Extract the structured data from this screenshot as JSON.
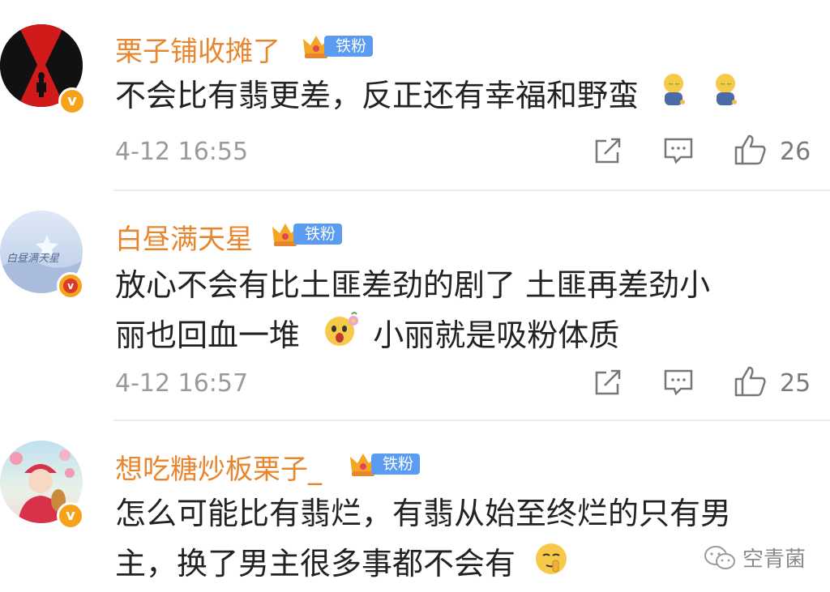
{
  "comments": [
    {
      "username": "栗子铺收摊了",
      "badge": "铁粉",
      "text_lines": [
        "不会比有翡更差，反正还有幸福和野蛮"
      ],
      "time": "4-12 16:55",
      "likes": "26",
      "avatar_icon": "black-widow-avatar"
    },
    {
      "username": "白昼满天星",
      "badge": "铁粉",
      "avatar_text": "白昼满天星",
      "text_lines": [
        "放心不会有比土匪差劲的剧了 土匪再差劲小",
        "丽也回血一堆",
        "小丽就是吸粉体质"
      ],
      "time": "4-12 16:57",
      "likes": "25"
    },
    {
      "username": "想吃糖炒板栗子_",
      "badge": "铁粉",
      "text_lines": [
        "怎么可能比有翡烂，有翡从始至终烂的只有男",
        "主，换了男主很多事都不会有"
      ]
    }
  ],
  "watermark": "空青菌",
  "colors": {
    "username": "#e8852f",
    "badge": "#5b9cf0",
    "verified": "#f7a21b"
  }
}
